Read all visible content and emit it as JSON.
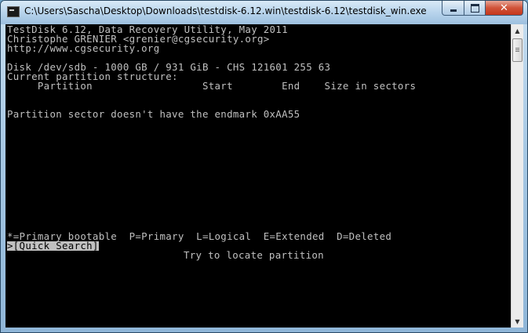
{
  "window": {
    "title": "C:\\Users\\Sascha\\Desktop\\Downloads\\testdisk-6.12.win\\testdisk-6.12\\testdisk_win.exe",
    "minimize": "minimize",
    "maximize": "maximize",
    "close": "close"
  },
  "console": {
    "header_line1": "TestDisk 6.12, Data Recovery Utility, May 2011",
    "header_line2": "Christophe GRENIER <grenier@cgsecurity.org>",
    "header_line3": "http://www.cgsecurity.org",
    "disk_info": "Disk /dev/sdb - 1000 GB / 931 GiB - CHS 121601 255 63",
    "structure_label": "Current partition structure:",
    "columns": "     Partition                  Start        End    Size in sectors",
    "message": "Partition sector doesn't have the endmark 0xAA55",
    "legend": "*=Primary bootable  P=Primary  L=Logical  E=Extended  D=Deleted",
    "menu_selected": ">[Quick Search]",
    "menu_hint": "Try to locate partition"
  },
  "colors": {
    "console_bg": "#000000",
    "console_fg": "#c0c0c0",
    "selection_bg": "#c0c0c0",
    "close_button": "#c5361a"
  }
}
